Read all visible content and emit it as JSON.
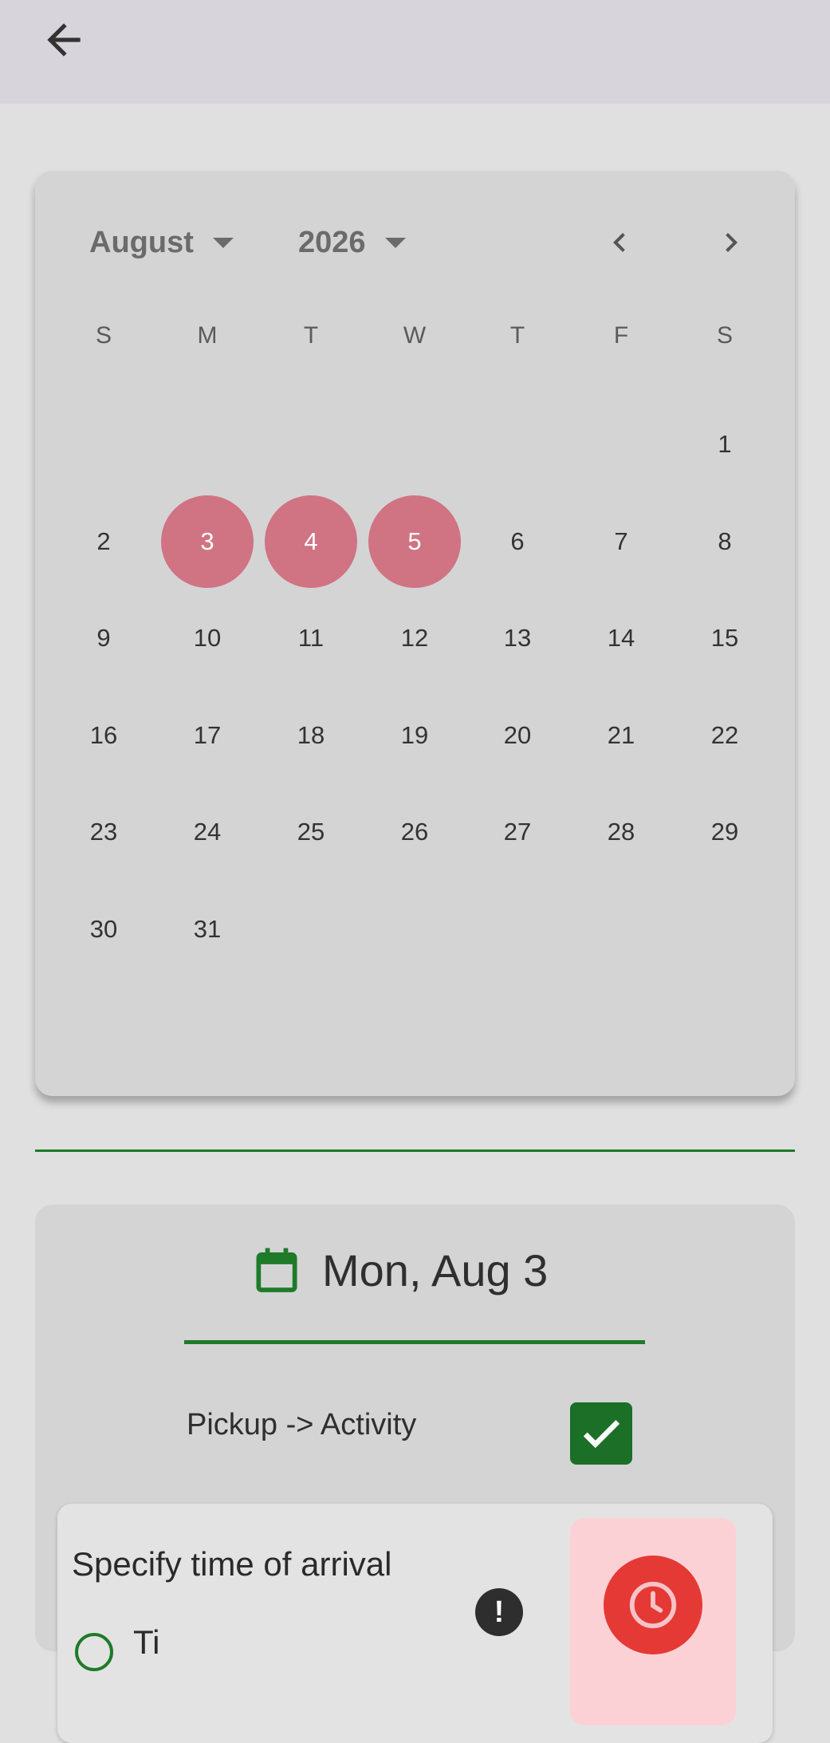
{
  "appbar": {
    "back_icon": "arrow-left-icon"
  },
  "calendar": {
    "month": "August",
    "year": "2026",
    "weekdays": [
      "S",
      "M",
      "T",
      "W",
      "T",
      "F",
      "S"
    ],
    "days": [
      "1",
      "2",
      "3",
      "4",
      "5",
      "6",
      "7",
      "8",
      "9",
      "10",
      "11",
      "12",
      "13",
      "14",
      "15",
      "16",
      "17",
      "18",
      "19",
      "20",
      "21",
      "22",
      "23",
      "24",
      "25",
      "26",
      "27",
      "28",
      "29",
      "30",
      "31"
    ],
    "first_weekday_index": 6,
    "selected_days": [
      "3",
      "4",
      "5"
    ],
    "selected_color": "#d07383"
  },
  "date_card": {
    "icon": "calendar-icon",
    "date_text": "Mon, Aug 3",
    "pickup_label": "Pickup -> Activity",
    "pickup_checked": true,
    "arrival": {
      "title": "Specify time of arrival",
      "time_text": "Ti",
      "alert_text": "!",
      "clock_icon": "clock-icon"
    }
  },
  "colors": {
    "accent_green": "#1f7a2a",
    "danger_red": "#e53935",
    "tile_pink": "#fcd1d6"
  }
}
